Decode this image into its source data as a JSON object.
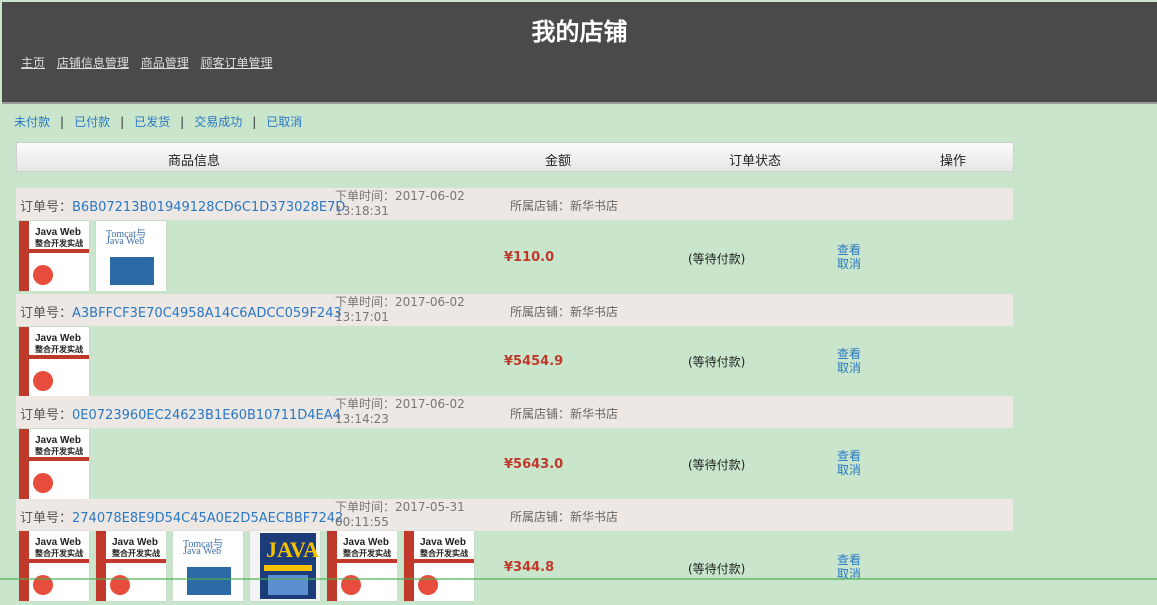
{
  "header": {
    "title": "我的店铺",
    "nav": [
      "主页",
      "店铺信息管理",
      "商品管理",
      "顾客订单管理"
    ]
  },
  "tabs": [
    "未付款",
    "已付款",
    "已发货",
    "交易成功",
    "已取消"
  ],
  "columns": [
    "商品信息",
    "金额",
    "订单状态",
    "操作"
  ],
  "labels": {
    "order_no": "订单号：",
    "time_prefix": "下单时间：",
    "shop_prefix": "所属店铺：",
    "view": "查看",
    "cancel": "取消"
  },
  "orders": [
    {
      "id": "B6B07213B01949128CD6C1D373028E7D",
      "date": "2017-06-02",
      "time": "13:18:31",
      "shop": "新华书店",
      "price": "¥110.0",
      "status": "(等待付款)"
    },
    {
      "id": "A3BFFCF3E70C4958A14C6ADCC059F243",
      "date": "2017-06-02",
      "time": "13:17:01",
      "shop": "新华书店",
      "price": "¥5454.9",
      "status": "(等待付款)"
    },
    {
      "id": "0E0723960EC24623B1E60B10711D4EA4",
      "date": "2017-06-02",
      "time": "13:14:23",
      "shop": "新华书店",
      "price": "¥5643.0",
      "status": "(等待付款)"
    },
    {
      "id": "274078E8E9D54C45A0E2D5AECBBF7242",
      "date": "2017-05-31",
      "time": "00:11:55",
      "shop": "新华书店",
      "price": "¥344.8",
      "status": "(等待付款)"
    }
  ],
  "books": {
    "javaweb": {
      "t1": "Java Web",
      "t2": "整合开发实战"
    },
    "tomcat": {
      "t1": "Tomcat与",
      "t2": "Java Web"
    },
    "java": {
      "t1": "JAVA"
    }
  }
}
